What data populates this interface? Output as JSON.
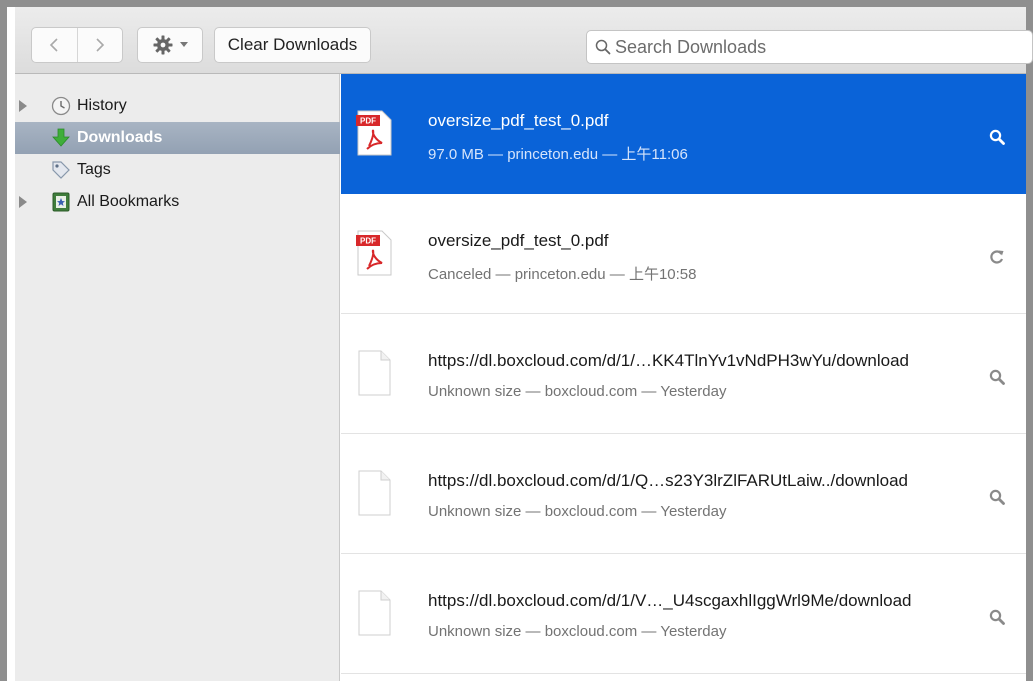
{
  "toolbar": {
    "back_icon": "chevron-left-icon",
    "forward_icon": "chevron-right-icon",
    "gear_icon": "gear-icon",
    "clear_label": "Clear Downloads",
    "search_placeholder": "Search Downloads",
    "search_value": ""
  },
  "sidebar": {
    "items": [
      {
        "label": "History",
        "icon": "clock-icon",
        "expandable": true,
        "selected": false
      },
      {
        "label": "Downloads",
        "icon": "download-arrow-icon",
        "expandable": false,
        "selected": true
      },
      {
        "label": "Tags",
        "icon": "tag-icon",
        "expandable": false,
        "selected": false
      },
      {
        "label": "All Bookmarks",
        "icon": "bookmarks-icon",
        "expandable": true,
        "selected": false
      }
    ]
  },
  "downloads": [
    {
      "name": "oversize_pdf_test_0.pdf",
      "meta": "97.0 MB — princeton.edu — 上午11:06",
      "type": "pdf",
      "action_icon": "magnifier-icon",
      "selected": true
    },
    {
      "name": "oversize_pdf_test_0.pdf",
      "meta": "Canceled — princeton.edu — 上午10:58",
      "type": "pdf",
      "action_icon": "retry-icon",
      "selected": false
    },
    {
      "name": "https://dl.boxcloud.com/d/1/…KK4TlnYv1vNdPH3wYu/download",
      "meta": "Unknown size — boxcloud.com — Yesterday",
      "type": "generic",
      "action_icon": "magnifier-icon",
      "selected": false
    },
    {
      "name": "https://dl.boxcloud.com/d/1/Q…s23Y3lrZlFARUtLaiw../download",
      "meta": "Unknown size — boxcloud.com — Yesterday",
      "type": "generic",
      "action_icon": "magnifier-icon",
      "selected": false
    },
    {
      "name": "https://dl.boxcloud.com/d/1/V…_U4scgaxhlIggWrl9Me/download",
      "meta": "Unknown size — boxcloud.com — Yesterday",
      "type": "generic",
      "action_icon": "magnifier-icon",
      "selected": false
    }
  ],
  "pdf_badge_text": "PDF",
  "colors": {
    "selection": "#0a63d8",
    "sidebar_selection": "#9ba8b9",
    "pdf_red": "#d8282a"
  }
}
